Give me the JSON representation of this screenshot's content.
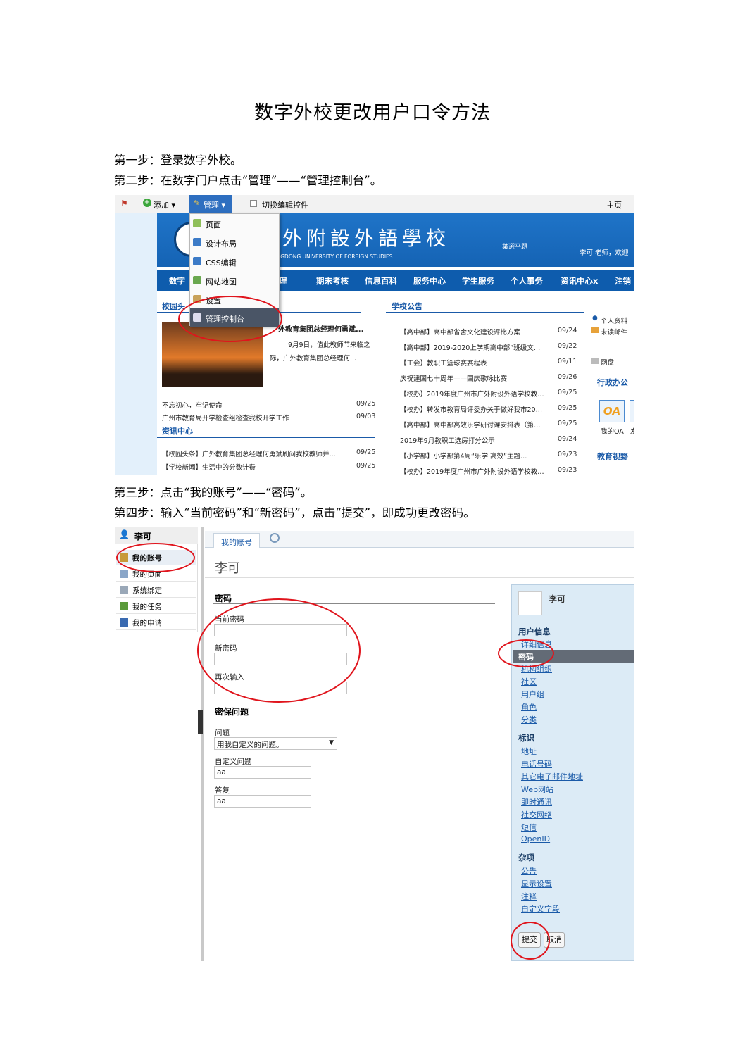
{
  "title": "数字外校更改用户口令方法",
  "steps": {
    "s1": "第一步：登录数字外校。",
    "s2": "第二步：在数字门户点击“管理”——“管理控制台”。",
    "s3": "第三步：点击“我的账号”——“密码”。",
    "s4": "第四步：输入“当前密码”和“新密码”，点击“提交”，即成功更改密码。"
  },
  "shot1": {
    "toolbar": {
      "add": "添加 ▾",
      "manage": "管理 ▾",
      "toggle": "切换编辑控件",
      "home": "主页"
    },
    "dropdown": [
      "页面",
      "设计布局",
      "CSS编辑",
      "网站地图",
      "设置",
      "管理控制台"
    ],
    "banner": {
      "school": "市廣外附設外語學校",
      "english": "L ATTACHED TO GUANGDONG UNIVERSITY OF FOREIGN STUDIES",
      "calligraphy": "葉選平題",
      "user": "李可 老师，欢迎"
    },
    "nav": [
      "数字",
      "理管理",
      "期末考核",
      "信息百科",
      "服务中心",
      "学生服务",
      "个人事务",
      "资讯中心x",
      "注销"
    ],
    "news_head": "校园头",
    "news_title": "外教育集团总经理何勇斌...",
    "news_desc1": "9月9日，值此教师节来临之",
    "news_desc2": "际，广外教育集团总经理何...",
    "left_news": [
      {
        "t": "不忘初心，牢记使命",
        "d": "09/25"
      },
      {
        "t": "广州市教育局开学检查组检查我校开学工作",
        "d": "09/03"
      }
    ],
    "info_center": "资讯中心",
    "info_news": [
      {
        "t": "【校园头条】广外教育集团总经理何勇斌刷问我校教师并...",
        "d": "09/25"
      },
      {
        "t": "【学校新闻】生活中的分数计费",
        "d": "09/25"
      }
    ],
    "notice_head": "学校公告",
    "notices": [
      {
        "t": "【高中部】高中部省舍文化建设评比方案",
        "d": "09/24"
      },
      {
        "t": "【高中部】2019-2020上学期高中部“班级文…",
        "d": "09/22"
      },
      {
        "t": "【工会】教职工篮球赛赛程表",
        "d": "09/11"
      },
      {
        "t": "庆祝建国七十周年——国庆歌咏比赛",
        "d": "09/26"
      },
      {
        "t": "【校办】2019年度广州市广外附设外语学校教…",
        "d": "09/25"
      },
      {
        "t": "【校办】转发市教育局评委办关于做好我市20…",
        "d": "09/25"
      },
      {
        "t": "【高中部】高中部高效乐学研讨课安排表（第…",
        "d": "09/25"
      },
      {
        "t": "2019年9月教职工选房打分公示",
        "d": "09/24"
      },
      {
        "t": "【小学部】小学部第4周“乐学·高效”主题…",
        "d": "09/23"
      },
      {
        "t": "【校办】2019年度广州市广外附设外语学校教…",
        "d": "09/23"
      }
    ],
    "side": {
      "personal": "个人资料",
      "mail": "未读邮件",
      "disk": "网盘",
      "office": "行政办公",
      "oa": "OA",
      "myoa": "我的OA",
      "more": "发",
      "vision": "教育视野"
    }
  },
  "shot2": {
    "user": "李可",
    "menu": [
      "我的账号",
      "我的页面",
      "系统绑定",
      "我的任务",
      "我的申请"
    ],
    "tab": "我的账号",
    "heading": "李可",
    "pw_section": "密码",
    "current_pw": "当前密码",
    "new_pw": "新密码",
    "repeat_pw": "再次输入",
    "sec_section": "密保问题",
    "question_label": "问题",
    "question_value": "用我自定义的问题。",
    "custom_q_label": "自定义问题",
    "custom_q_value": "aa",
    "answer_label": "答复",
    "answer_value": "aa",
    "right": {
      "name": "李可",
      "user_info": "用户信息",
      "user_info_links": [
        "详细信息",
        "密码",
        "机构组织",
        "社区",
        "用户组",
        "角色",
        "分类"
      ],
      "ident": "标识",
      "ident_links": [
        "地址",
        "电话号码",
        "其它电子邮件地址",
        "Web网站",
        "即时通讯",
        "社交网络",
        "短信",
        "OpenID"
      ],
      "misc": "杂项",
      "misc_links": [
        "公告",
        "显示设置",
        "注释",
        "自定义字段"
      ],
      "submit": "提交",
      "cancel": "取消"
    }
  },
  "colors": {
    "accent": "#0e5cad",
    "circle": "#e0141c",
    "rightpanel": "#dcebf6"
  }
}
